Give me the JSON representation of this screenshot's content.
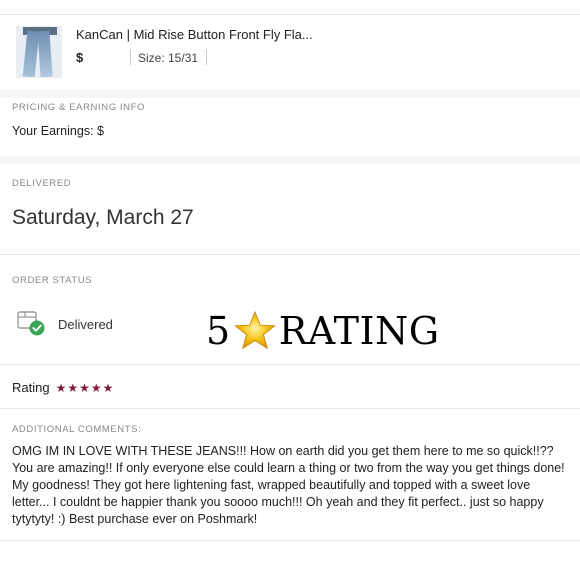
{
  "product": {
    "title": "KanCan | Mid Rise Button Front Fly Fla...",
    "price": "$",
    "size": "Size: 15/31",
    "image_name": "jeans-thumbnail"
  },
  "pricing": {
    "label": "PRICING & EARNING INFO",
    "earnings": "Your Earnings: $"
  },
  "delivered": {
    "label": "DELIVERED",
    "date": "Saturday, March 27"
  },
  "order_status": {
    "label": "ORDER STATUS",
    "status": "Delivered",
    "icon": "package-check-icon"
  },
  "overlay": {
    "number": "5",
    "word": "RATING",
    "icon": "star-icon"
  },
  "rating": {
    "label": "Rating",
    "stars": 5,
    "max_stars": 5,
    "star_color": "#7d1d3a"
  },
  "comments": {
    "label": "ADDITIONAL COMMENTS:",
    "text": "OMG IM IN LOVE WITH THESE JEANS!!! How on earth did you get them here to me so quick!!?? You are amazing!! If only everyone else could learn a thing or two from the way you get things done! My goodness! They got here lightening fast, wrapped beautifully and topped with a sweet love letter... I couldnt be happier thank you soooo much!!! Oh yeah and they fit perfect.. just so happy tytytyty! :) Best purchase ever on Poshmark!"
  },
  "colors": {
    "accent_green": "#3aa757",
    "rating_star": "#7d1d3a",
    "overlay_star": "#f5c518"
  }
}
